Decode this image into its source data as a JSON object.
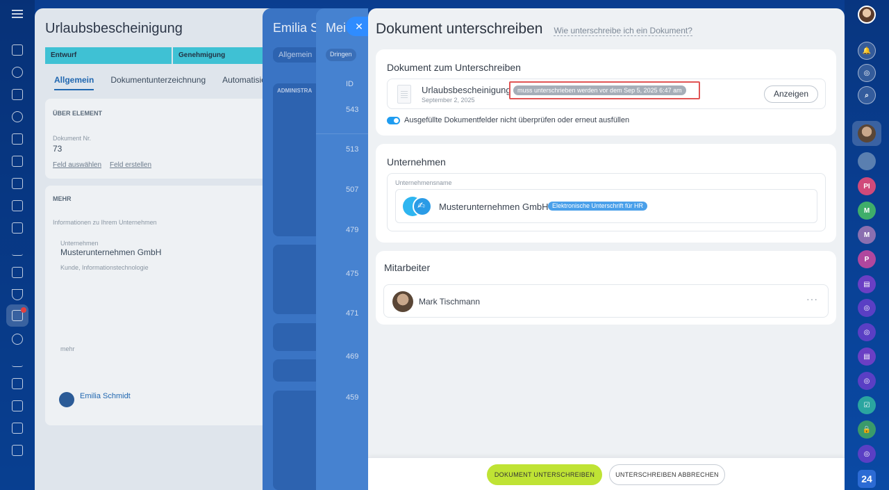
{
  "bg_panel_a": {
    "title": "Urlaubsbescheinigung",
    "stages": [
      "Entwurf",
      "Genehmigung"
    ],
    "tabs": [
      "Allgemein",
      "Dokumentunterzeichnung",
      "Automatisie"
    ],
    "section1": "ÜBER ELEMENT",
    "doc_no_label": "Dokument Nr.",
    "doc_no_value": "73",
    "link_select": "Feld auswählen",
    "link_create": "Feld erstellen",
    "section2": "MEHR",
    "info_label": "Informationen zu Ihrem Unternehmen",
    "company_label": "Unternehmen",
    "company_name": "Musterunternehmen GmbH",
    "company_meta": "Kunde, Informationstechnologie",
    "more_link": "mehr",
    "person_name": "Emilia Schmidt"
  },
  "bg_panel_b": {
    "title": "Emilia S",
    "tab": "Allgemein",
    "label": "ADMINISTRA"
  },
  "bg_panel_c": {
    "title": "Mei",
    "badge": "Dringen",
    "id_header": "ID",
    "ids": [
      "543",
      "513",
      "507",
      "479",
      "475",
      "471",
      "469",
      "459"
    ]
  },
  "modal": {
    "title": "Dokument unterschreiben",
    "help_link": "Wie unterschreibe ich ein Dokument?",
    "doc_section": {
      "heading": "Dokument zum Unterschreiben",
      "doc_name": "Urlaubsbescheinigung",
      "doc_date": "September 2, 2025",
      "deadline": "muss unterschrieben werden vor dem Sep 5, 2025 6:47 am",
      "show_button": "Anzeigen",
      "toggle_label": "Ausgefüllte Dokumentfelder nicht überprüfen oder erneut ausfüllen"
    },
    "company_section": {
      "heading": "Unternehmen",
      "field_label": "Unternehmensname",
      "company_name": "Musterunternehmen GmbH",
      "badge": "Elektronische Unterschrift für HR"
    },
    "employee_section": {
      "heading": "Mitarbeiter",
      "employee_name": "Mark Tischmann",
      "more": "···"
    },
    "footer": {
      "sign_button": "DOKUMENT UNTERSCHREIBEN",
      "cancel_button": "UNTERSCHREIBEN ABBRECHEN"
    }
  },
  "rightbar": {
    "avatars": [
      "PI",
      "M",
      "M",
      "P"
    ],
    "logo": "24"
  },
  "colors": {
    "accent": "#2f8cff",
    "sign_button": "#bfe334",
    "deadline_highlight": "#e05454",
    "badge_blue": "#4aa0ea"
  }
}
